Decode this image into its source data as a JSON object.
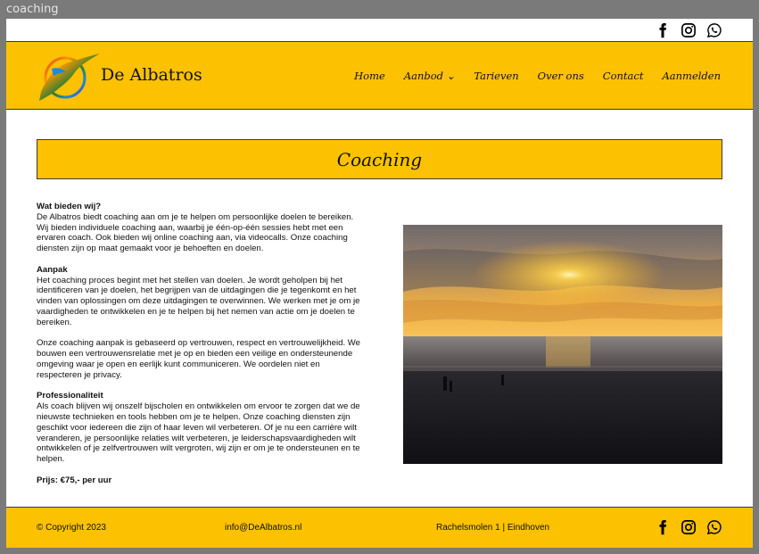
{
  "window": {
    "title": "coaching"
  },
  "header": {
    "brand": "De Albatros",
    "social": [
      "facebook-icon",
      "instagram-icon",
      "whatsapp-icon"
    ]
  },
  "nav": {
    "items": [
      {
        "label": "Home"
      },
      {
        "label": "Aanbod ⌄"
      },
      {
        "label": "Tarieven"
      },
      {
        "label": "Over ons"
      },
      {
        "label": "Contact"
      },
      {
        "label": "Aanmelden"
      }
    ]
  },
  "main": {
    "title": "Coaching",
    "sections": [
      {
        "heading": "Wat bieden wij?",
        "body": "De Albatros biedt coaching aan om je te helpen om persoonlijke doelen te bereiken. Wij bieden individuele coaching aan, waarbij je één-op-één sessies hebt met een ervaren coach. Ook bieden wij online coaching aan, via videocalls. Onze coaching diensten zijn op maat gemaakt voor je behoeften en doelen."
      },
      {
        "heading": "Aanpak",
        "body": "Het coaching proces begint met het stellen van doelen. Je wordt geholpen bij het identificeren van je doelen, het begrijpen van de uitdagingen die je tegenkomt en het vinden van oplossingen om deze uitdagingen te overwinnen. We werken met je om je vaardigheden te ontwikkelen en je te helpen bij het nemen van actie om je doelen te bereiken."
      },
      {
        "heading": "",
        "body": "Onze coaching aanpak is gebaseerd op vertrouwen, respect en vertrouwelijkheid. We bouwen een vertrouwensrelatie met je op en bieden een veilige en ondersteunende omgeving waar je open en eerlijk kunt communiceren. We oordelen niet en respecteren je privacy."
      },
      {
        "heading": "Professionaliteit",
        "body": "Als coach blijven wij onszelf bijscholen en ontwikkelen om ervoor te zorgen dat we de nieuwste technieken en tools hebben om je te helpen. Onze coaching diensten zijn geschikt voor iedereen die zijn of haar leven wil verbeteren. Of je nu een carrière wilt veranderen, je persoonlijke relaties wilt verbeteren, je leiderschapsvaardigheden wilt ontwikkelen of je zelfvertrouwen wilt vergroten, wij zijn er om je te ondersteunen en te helpen."
      }
    ],
    "price": "Prijs: €75,- per uur"
  },
  "footer": {
    "copyright": "© Copyright 2023",
    "email": "info@DeAlbatros.nl",
    "address": "Rachelsmolen 1 | Eindhoven",
    "social": [
      "facebook-icon",
      "instagram-icon",
      "whatsapp-icon"
    ]
  },
  "colors": {
    "accent": "#fcc100",
    "border": "#3a3a3a",
    "text": "#111111"
  }
}
